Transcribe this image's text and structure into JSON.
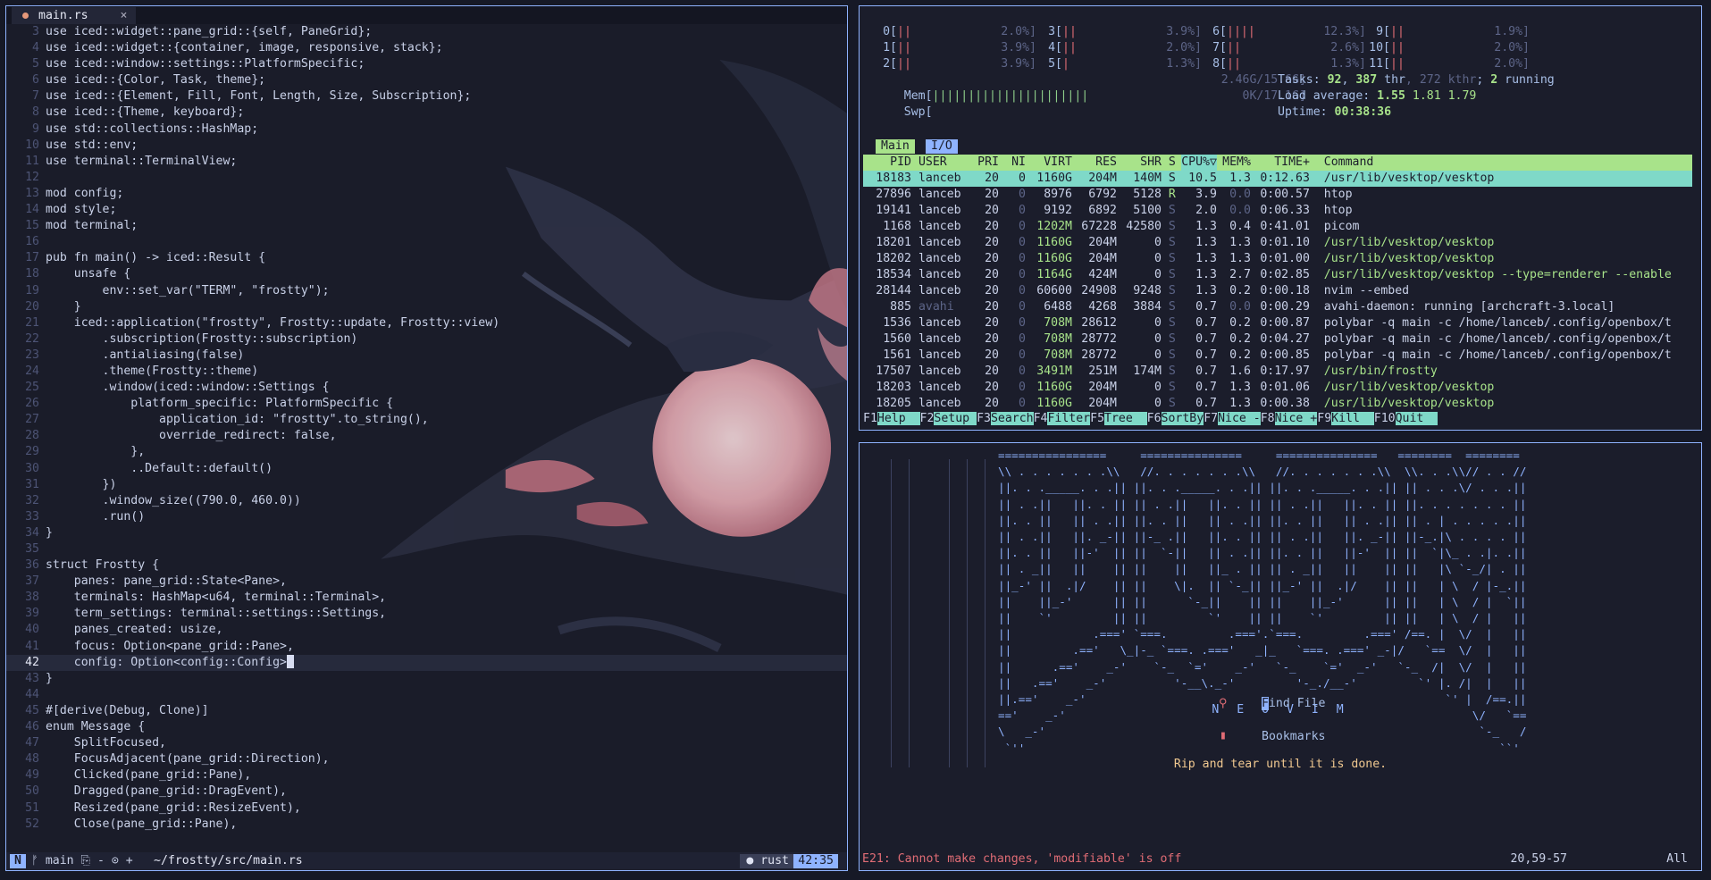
{
  "editor": {
    "tab": {
      "name": "main.rs",
      "close": "×"
    },
    "current_line": 42,
    "lines": [
      {
        "n": "3",
        "t": "use iced::widget::pane_grid::{self, PaneGrid};"
      },
      {
        "n": "4",
        "t": "use iced::widget::{container, image, responsive, stack};"
      },
      {
        "n": "5",
        "t": "use iced::window::settings::PlatformSpecific;"
      },
      {
        "n": "6",
        "t": "use iced::{Color, Task, theme};"
      },
      {
        "n": "7",
        "t": "use iced::{Element, Fill, Font, Length, Size, Subscription};"
      },
      {
        "n": "8",
        "t": "use iced::{Theme, keyboard};"
      },
      {
        "n": "9",
        "t": "use std::collections::HashMap;"
      },
      {
        "n": "10",
        "t": "use std::env;"
      },
      {
        "n": "11",
        "t": "use terminal::TerminalView;"
      },
      {
        "n": "12",
        "t": ""
      },
      {
        "n": "13",
        "t": "mod config;"
      },
      {
        "n": "14",
        "t": "mod style;"
      },
      {
        "n": "15",
        "t": "mod terminal;"
      },
      {
        "n": "16",
        "t": ""
      },
      {
        "n": "17",
        "t": "pub fn main() -> iced::Result {"
      },
      {
        "n": "18",
        "t": "    unsafe {"
      },
      {
        "n": "19",
        "t": "        env::set_var(\"TERM\", \"frostty\");"
      },
      {
        "n": "20",
        "t": "    }"
      },
      {
        "n": "21",
        "t": "    iced::application(\"frostty\", Frostty::update, Frostty::view)"
      },
      {
        "n": "22",
        "t": "        .subscription(Frostty::subscription)"
      },
      {
        "n": "23",
        "t": "        .antialiasing(false)"
      },
      {
        "n": "24",
        "t": "        .theme(Frostty::theme)"
      },
      {
        "n": "25",
        "t": "        .window(iced::window::Settings {"
      },
      {
        "n": "26",
        "t": "            platform_specific: PlatformSpecific {"
      },
      {
        "n": "27",
        "t": "                application_id: \"frostty\".to_string(),"
      },
      {
        "n": "28",
        "t": "                override_redirect: false,"
      },
      {
        "n": "29",
        "t": "            },"
      },
      {
        "n": "30",
        "t": "            ..Default::default()"
      },
      {
        "n": "31",
        "t": "        })"
      },
      {
        "n": "32",
        "t": "        .window_size((790.0, 460.0))"
      },
      {
        "n": "33",
        "t": "        .run()"
      },
      {
        "n": "34",
        "t": "}"
      },
      {
        "n": "35",
        "t": ""
      },
      {
        "n": "36",
        "t": "struct Frostty {"
      },
      {
        "n": "37",
        "t": "    panes: pane_grid::State<Pane>,"
      },
      {
        "n": "38",
        "t": "    terminals: HashMap<u64, terminal::Terminal>,"
      },
      {
        "n": "39",
        "t": "    term_settings: terminal::settings::Settings,"
      },
      {
        "n": "40",
        "t": "    panes_created: usize,"
      },
      {
        "n": "41",
        "t": "    focus: Option<pane_grid::Pane>,"
      },
      {
        "n": "42",
        "t": "    config: Option<config::Config>"
      },
      {
        "n": "43",
        "t": "}"
      },
      {
        "n": "44",
        "t": ""
      },
      {
        "n": "45",
        "t": "#[derive(Debug, Clone)]"
      },
      {
        "n": "46",
        "t": "enum Message {"
      },
      {
        "n": "47",
        "t": "    SplitFocused,"
      },
      {
        "n": "48",
        "t": "    FocusAdjacent(pane_grid::Direction),"
      },
      {
        "n": "49",
        "t": "    Clicked(pane_grid::Pane),"
      },
      {
        "n": "50",
        "t": "    Dragged(pane_grid::DragEvent),"
      },
      {
        "n": "51",
        "t": "    Resized(pane_grid::ResizeEvent),"
      },
      {
        "n": "52",
        "t": "    Close(pane_grid::Pane),"
      }
    ],
    "status": {
      "mode": "N",
      "branch": "ᚠ main ⎘ - ⊙ +",
      "path": "~/frostty/src/main.rs",
      "filetype": "● rust",
      "position": "42:35"
    }
  },
  "htop": {
    "cpus": [
      {
        "id": "0[",
        "bar": "||",
        "pct": "2.0%]",
        "col": 0,
        "row": 0
      },
      {
        "id": "1[",
        "bar": "||",
        "pct": "3.9%]",
        "col": 0,
        "row": 1
      },
      {
        "id": "2[",
        "bar": "||",
        "pct": "3.9%]",
        "col": 0,
        "row": 2
      },
      {
        "id": "3[",
        "bar": "||",
        "pct": "3.9%]",
        "col": 1,
        "row": 0
      },
      {
        "id": "4[",
        "bar": "||",
        "pct": "2.0%]",
        "col": 1,
        "row": 1
      },
      {
        "id": "5[",
        "bar": "|",
        "pct": "1.3%]",
        "col": 1,
        "row": 2
      },
      {
        "id": "6[",
        "bar": "||||",
        "pct": "12.3%]",
        "col": 2,
        "row": 0
      },
      {
        "id": "7[",
        "bar": "||",
        "pct": "2.6%]",
        "col": 2,
        "row": 1
      },
      {
        "id": "8[",
        "bar": "||",
        "pct": "1.3%]",
        "col": 2,
        "row": 2
      },
      {
        "id": "9[",
        "bar": "||",
        "pct": "1.9%]",
        "col": 3,
        "row": 0
      },
      {
        "id": "10[",
        "bar": "||",
        "pct": "2.0%]",
        "col": 3,
        "row": 1
      },
      {
        "id": "11[",
        "bar": "||",
        "pct": "2.0%]",
        "col": 3,
        "row": 2
      }
    ],
    "mem": {
      "label": "Mem[",
      "bar": "||||||||||||||||||||||",
      "value": "2.46G/15.6G]"
    },
    "swp": {
      "label": "Swp[",
      "value": "0K/17.1G]"
    },
    "tasks": {
      "label": "Tasks: ",
      "tasks": "92",
      "sep": ", ",
      "thr": "387",
      "thr_label": " thr",
      "kthr": ", 272 kthr",
      "running_sep": "; ",
      "running": "2",
      "running_label": " running"
    },
    "load": {
      "label": "Load average: ",
      "v1": "1.55",
      "v2": "1.81",
      "v3": "1.79"
    },
    "uptime": {
      "label": "Uptime: ",
      "value": "00:38:36"
    },
    "tabs": [
      "Main",
      "I/O"
    ],
    "header": {
      "pid": "PID",
      "user": "USER",
      "pri": "PRI",
      "ni": "NI",
      "virt": "VIRT",
      "res": "RES",
      "shr": "SHR",
      "s": "S",
      "cpu": "CPU%▽",
      "mem": "MEM%",
      "time": "TIME+",
      "cmd": "Command"
    },
    "processes": [
      {
        "pid": "18183",
        "user": "lanceb",
        "pri": "20",
        "ni": "0",
        "virt": "1160G",
        "res": "204M",
        "shr": "140M",
        "s": "S",
        "cpu": "10.5",
        "mem": "1.3",
        "time": "0:12.63",
        "cmd": "/usr/lib/vesktop/vesktop"
      },
      {
        "pid": "27896",
        "user": "lanceb",
        "pri": "20",
        "ni": "0",
        "virt": "8976",
        "res": "6792",
        "shr": "5128",
        "s": "R",
        "cpu": "3.9",
        "mem": "0.0",
        "time": "0:00.57",
        "cmd": "htop"
      },
      {
        "pid": "19141",
        "user": "lanceb",
        "pri": "20",
        "ni": "0",
        "virt": "9192",
        "res": "6892",
        "shr": "5100",
        "s": "S",
        "cpu": "2.0",
        "mem": "0.0",
        "time": "0:06.33",
        "cmd": "htop"
      },
      {
        "pid": "1168",
        "user": "lanceb",
        "pri": "20",
        "ni": "0",
        "virt": "1202M",
        "res": "67228",
        "shr": "42580",
        "s": "S",
        "cpu": "1.3",
        "mem": "0.4",
        "time": "0:41.01",
        "cmd": "picom"
      },
      {
        "pid": "18201",
        "user": "lanceb",
        "pri": "20",
        "ni": "0",
        "virt": "1160G",
        "res": "204M",
        "shr": "0",
        "s": "S",
        "cpu": "1.3",
        "mem": "1.3",
        "time": "0:01.10",
        "cmd": "/usr/lib/vesktop/vesktop"
      },
      {
        "pid": "18202",
        "user": "lanceb",
        "pri": "20",
        "ni": "0",
        "virt": "1160G",
        "res": "204M",
        "shr": "0",
        "s": "S",
        "cpu": "1.3",
        "mem": "1.3",
        "time": "0:01.00",
        "cmd": "/usr/lib/vesktop/vesktop"
      },
      {
        "pid": "18534",
        "user": "lanceb",
        "pri": "20",
        "ni": "0",
        "virt": "1164G",
        "res": "424M",
        "shr": "0",
        "s": "S",
        "cpu": "1.3",
        "mem": "2.7",
        "time": "0:02.85",
        "cmd": "/usr/lib/vesktop/vesktop --type=renderer --enable"
      },
      {
        "pid": "28144",
        "user": "lanceb",
        "pri": "20",
        "ni": "0",
        "virt": "60600",
        "res": "24908",
        "shr": "9248",
        "s": "S",
        "cpu": "1.3",
        "mem": "0.2",
        "time": "0:00.18",
        "cmd": "nvim --embed"
      },
      {
        "pid": "885",
        "user": "avahi",
        "pri": "20",
        "ni": "0",
        "virt": "6488",
        "res": "4268",
        "shr": "3884",
        "s": "S",
        "cpu": "0.7",
        "mem": "0.0",
        "time": "0:00.29",
        "cmd": "avahi-daemon: running [archcraft-3.local]"
      },
      {
        "pid": "1536",
        "user": "lanceb",
        "pri": "20",
        "ni": "0",
        "virt": "708M",
        "res": "28612",
        "shr": "0",
        "s": "S",
        "cpu": "0.7",
        "mem": "0.2",
        "time": "0:00.87",
        "cmd": "polybar -q main -c /home/lanceb/.config/openbox/t"
      },
      {
        "pid": "1560",
        "user": "lanceb",
        "pri": "20",
        "ni": "0",
        "virt": "708M",
        "res": "28772",
        "shr": "0",
        "s": "S",
        "cpu": "0.7",
        "mem": "0.2",
        "time": "0:04.27",
        "cmd": "polybar -q main -c /home/lanceb/.config/openbox/t"
      },
      {
        "pid": "1561",
        "user": "lanceb",
        "pri": "20",
        "ni": "0",
        "virt": "708M",
        "res": "28772",
        "shr": "0",
        "s": "S",
        "cpu": "0.7",
        "mem": "0.2",
        "time": "0:00.85",
        "cmd": "polybar -q main -c /home/lanceb/.config/openbox/t"
      },
      {
        "pid": "17507",
        "user": "lanceb",
        "pri": "20",
        "ni": "0",
        "virt": "3491M",
        "res": "251M",
        "shr": "174M",
        "s": "S",
        "cpu": "0.7",
        "mem": "1.6",
        "time": "0:17.97",
        "cmd": "/usr/bin/frostty"
      },
      {
        "pid": "18203",
        "user": "lanceb",
        "pri": "20",
        "ni": "0",
        "virt": "1160G",
        "res": "204M",
        "shr": "0",
        "s": "S",
        "cpu": "0.7",
        "mem": "1.3",
        "time": "0:01.06",
        "cmd": "/usr/lib/vesktop/vesktop"
      },
      {
        "pid": "18205",
        "user": "lanceb",
        "pri": "20",
        "ni": "0",
        "virt": "1160G",
        "res": "204M",
        "shr": "0",
        "s": "S",
        "cpu": "0.7",
        "mem": "1.3",
        "time": "0:00.38",
        "cmd": "/usr/lib/vesktop/vesktop"
      }
    ],
    "fkeys": [
      {
        "key": "F1",
        "label": "Help  "
      },
      {
        "key": "F2",
        "label": "Setup "
      },
      {
        "key": "F3",
        "label": "Search"
      },
      {
        "key": "F4",
        "label": "Filter"
      },
      {
        "key": "F5",
        "label": "Tree  "
      },
      {
        "key": "F6",
        "label": "SortBy"
      },
      {
        "key": "F7",
        "label": "Nice -"
      },
      {
        "key": "F8",
        "label": "Nice +"
      },
      {
        "key": "F9",
        "label": "Kill  "
      },
      {
        "key": "F10",
        "label": "Quit  "
      }
    ]
  },
  "dashboard": {
    "ascii_art": "================     ===============     ===============   ========  ========\n\\\\ . . . . . . .\\\\   //. . . . . . .\\\\   //. . . . . . .\\\\  \\\\. . .\\\\// . . //\n||. . ._____. . .|| ||. . ._____. . .|| ||. . ._____. . .|| || . . .\\/ . . .||\n|| . .||   ||. . || || . .||   ||. . || || . .||   ||. . || ||. . . . . . . ||\n||. . ||   || . .|| ||. . ||   || . .|| ||. . ||   || . .|| || . | . . . . .||\n|| . .||   ||. _-|| ||-_ .||   ||. . || || . .||   ||. _-|| ||-_.|\\ . . . . ||\n||. . ||   ||-'  || ||  `-||   || . .|| ||. . ||   ||-'  || ||  `|\\_ . .|. .||\n|| . _||   ||    || ||    ||   ||_ . || || . _||   ||    || ||   |\\ `-_/| . ||\n||_-' ||  .|/    || ||    \\|.  || `-_|| ||_-' ||  .|/    || ||   | \\  / |-_.||\n||    ||_-'      || ||      `-_||    || ||    ||_-'      || ||   | \\  / |  `||\n||    `'         || ||         `'    || ||    `'         || ||   | \\  / |   ||\n||            .===' `===.         .==='.`===.         .===' /==. |  \\/  |   ||\n||         .=='   \\_|-_ `===. .==='   _|_   `===. .===' _-|/   `==  \\/  |   ||\n||      .=='    _-'    `-_  `='    _-'   `-_    `='  _-'   `-_  /|  \\/  |   ||\n||   .=='    _-'          '-__\\._-'         '-_./__-'         `' |. /|  |   ||\n||.=='    _-'                                                     `' |  /==.||\n=='    _-'                                                            \\/   `==\n\\   _-'                                                                `-_   /\n `''                                                                      ``'",
    "title": "N E O V I M",
    "items": [
      {
        "icon": "⚲",
        "label": "Find File"
      },
      {
        "icon": "▮",
        "label": "Bookmarks"
      }
    ],
    "quote": "Rip and tear until it is done.",
    "error": "E21: Cannot make changes, 'modifiable' is off",
    "ruler": "20,59-57",
    "scroll": "All"
  },
  "colors": {
    "accent": "#8fb3ff",
    "htop_header": "#a8e38a",
    "htop_selection": "#7fd9c8",
    "error": "#e06c75",
    "quote": "#f0c890"
  }
}
